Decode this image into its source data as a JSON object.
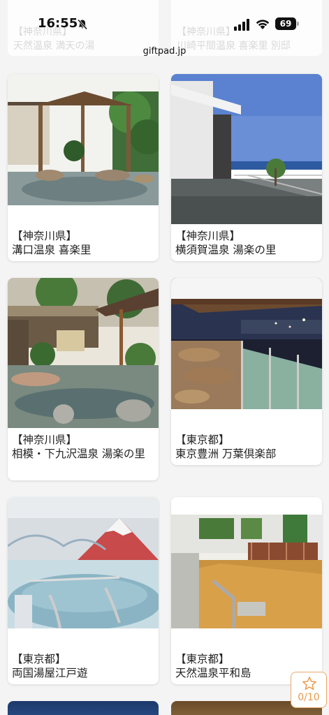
{
  "status_bar": {
    "time": "16:55",
    "battery": "69"
  },
  "url": "giftpad.jp",
  "ghost_cards": [
    {
      "line1": "【神奈川県】",
      "line2": "天然温泉 満天の湯"
    },
    {
      "line1": "【神奈川県】",
      "line2": "川崎平間温泉 喜楽里 別邸"
    }
  ],
  "cards": [
    {
      "prefecture": "【神奈川県】",
      "name": "溝口温泉 喜楽里"
    },
    {
      "prefecture": "【神奈川県】",
      "name": "横須賀温泉 湯楽の里"
    },
    {
      "prefecture": "【神奈川県】",
      "name": "相模・下九沢温泉 湯楽の里"
    },
    {
      "prefecture": "【東京都】",
      "name": "東京豊洲 万葉倶楽部"
    },
    {
      "prefecture": "【東京都】",
      "name": "両国湯屋江戸遊"
    },
    {
      "prefecture": "【東京都】",
      "name": "天然温泉平和島"
    }
  ],
  "favorite": {
    "count": "0/10",
    "icon": "star-icon",
    "color": "#e89a4a"
  },
  "icons": [
    "bell-slash-icon",
    "signal-icon",
    "wifi-icon",
    "battery-icon",
    "star-icon"
  ]
}
